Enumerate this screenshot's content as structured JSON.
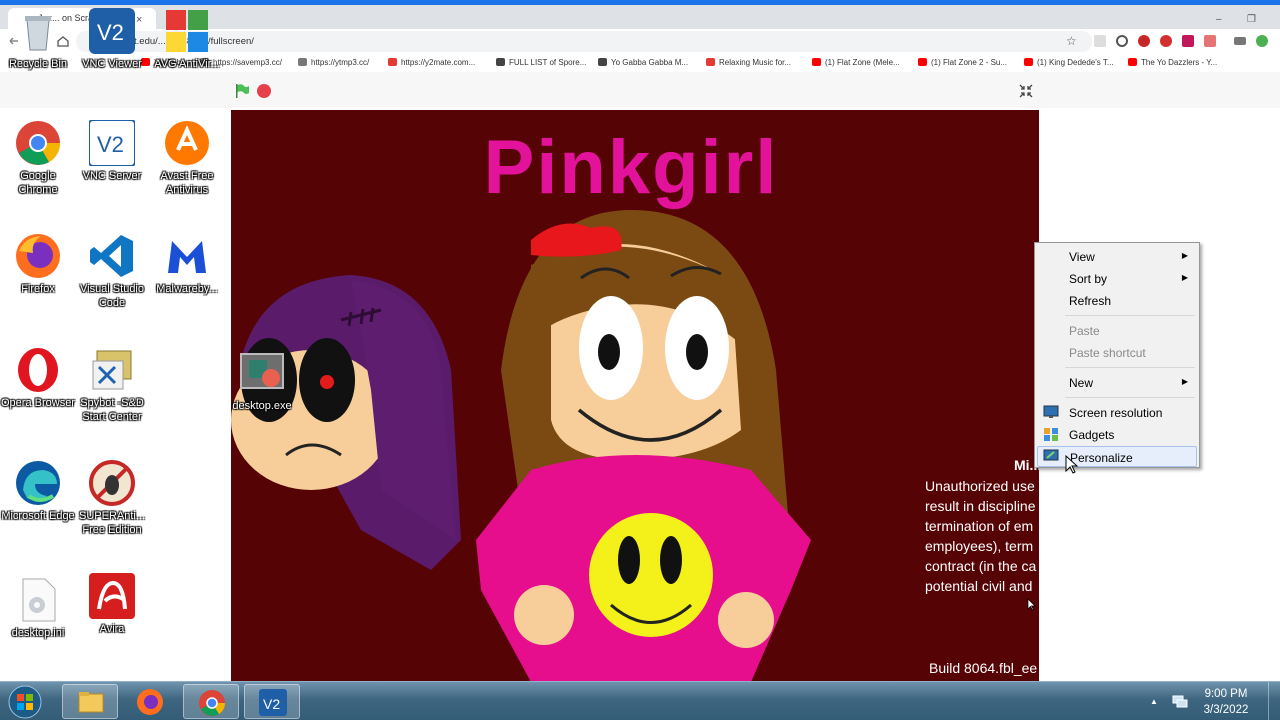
{
  "browser": {
    "tab_title": "Jaz... on Scra...",
    "tab_close": "×",
    "url": "mit.edu/...53948931/fullscreen/",
    "window_minimize": "–",
    "window_restore": "❐",
    "bookmarks": [
      {
        "label": "YouTube",
        "color": "#ff0000"
      },
      {
        "label": "https://savemp3.cc/",
        "color": "#777777"
      },
      {
        "label": "https://ytmp3.cc/",
        "color": "#777777"
      },
      {
        "label": "https://y2mate.com...",
        "color": "#e53935"
      },
      {
        "label": "FULL LIST of Spore...",
        "color": "#444444"
      },
      {
        "label": "Yo Gabba Gabba M...",
        "color": "#444444"
      },
      {
        "label": "Relaxing Music for...",
        "color": "#e53935"
      },
      {
        "label": "(1) Flat Zone (Mele...",
        "color": "#ff0000"
      },
      {
        "label": "(1) Flat Zone 2 - Su...",
        "color": "#ff0000"
      },
      {
        "label": "(1) King Dedede's T...",
        "color": "#ff0000"
      },
      {
        "label": "The Yo Dazzlers - Y...",
        "color": "#ff0000"
      }
    ]
  },
  "stage": {
    "title": "Pinkgirl",
    "title_color": "#e3129b",
    "background": "#560306",
    "legal_title": "Mi...",
    "legal_lines": [
      "Unauthorized use",
      "result in discipline",
      "termination of em",
      "employees), term",
      "contract (in the ca",
      "potential civil and"
    ],
    "build": "Build 8064.fbl_ee"
  },
  "desktop_icons": [
    {
      "label": "Recycle Bin",
      "icon": "recycle-bin-icon"
    },
    {
      "label": "VNC Viewer",
      "icon": "vnc-viewer-icon"
    },
    {
      "label": "AVG AntiVir...",
      "icon": "avg-antivirus-icon"
    },
    {
      "label": "Google Chrome",
      "icon": "chrome-icon"
    },
    {
      "label": "VNC Server",
      "icon": "vnc-server-icon"
    },
    {
      "label": "Avast Free Antivirus",
      "icon": "avast-icon"
    },
    {
      "label": "Firefox",
      "icon": "firefox-icon"
    },
    {
      "label": "Visual Studio Code",
      "icon": "vscode-icon"
    },
    {
      "label": "Malwareby...",
      "icon": "malwarebytes-icon"
    },
    {
      "label": "Opera Browser",
      "icon": "opera-icon"
    },
    {
      "label": "Spybot -S&D Start Center",
      "icon": "spybot-icon"
    },
    {
      "label": "desktop.exe",
      "icon": "desktop-exe-icon"
    },
    {
      "label": "Microsoft Edge",
      "icon": "edge-icon"
    },
    {
      "label": "SUPERAnti... Free Edition",
      "icon": "superantispyware-icon"
    },
    {
      "label": "desktop.ini",
      "icon": "desktop-ini-icon"
    },
    {
      "label": "Avira",
      "icon": "avira-icon"
    }
  ],
  "context_menu": {
    "items": [
      {
        "label": "View",
        "submenu": true,
        "disabled": false
      },
      {
        "label": "Sort by",
        "submenu": true,
        "disabled": false
      },
      {
        "label": "Refresh",
        "submenu": false,
        "disabled": false
      },
      {
        "label": "Paste",
        "submenu": false,
        "disabled": true
      },
      {
        "label": "Paste shortcut",
        "submenu": false,
        "disabled": true
      },
      {
        "label": "New",
        "submenu": true,
        "disabled": false
      },
      {
        "label": "Screen resolution",
        "submenu": false,
        "disabled": false,
        "icon": "screen-resolution-icon"
      },
      {
        "label": "Gadgets",
        "submenu": false,
        "disabled": false,
        "icon": "gadgets-icon"
      },
      {
        "label": "Personalize",
        "submenu": false,
        "disabled": false,
        "icon": "personalize-icon",
        "highlighted": true
      }
    ],
    "submenu_arrow": "▶"
  },
  "taskbar": {
    "time": "9:00 PM",
    "date": "3/3/2022",
    "tray_arrow": "▲",
    "pinned": [
      "explorer-icon",
      "firefox-icon",
      "chrome-icon",
      "vnc-viewer-icon"
    ]
  }
}
